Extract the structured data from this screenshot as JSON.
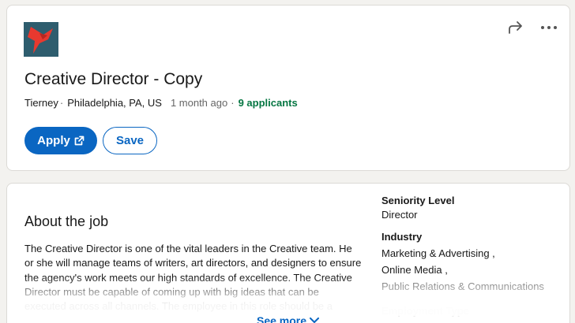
{
  "job": {
    "title": "Creative Director - Copy",
    "company": "Tierney",
    "location": "Philadelphia, PA, US",
    "posted": "1 month ago",
    "applicants": "9 applicants",
    "apply_label": "Apply",
    "save_label": "Save"
  },
  "icons": {
    "logo": "company-logo",
    "share": "share-icon",
    "more": "more-icon",
    "external": "external-link-icon",
    "chevron": "chevron-down-icon"
  },
  "about": {
    "heading": "About the job",
    "text": "The Creative Director is one of the vital leaders in the Creative team. He or she will manage teams of writers, art directors, and designers to ensure the agency's work meets our high standards of excellence. The Creative Director must be capable of coming up with big ideas that can be executed across all channels. The employee in this role should be a",
    "see_more": "See more"
  },
  "criteria": {
    "seniority_label": "Seniority Level",
    "seniority_value": "Director",
    "industry_label": "Industry",
    "industry_values": [
      "Marketing & Advertising ,",
      "Online Media ,",
      "Public Relations & Communications"
    ],
    "next_label": "Employment Type"
  },
  "colors": {
    "accent": "#0a66c2",
    "applicants": "#057642",
    "logo_bg": "#2e5d6e",
    "logo_mark": "#e8392f"
  }
}
